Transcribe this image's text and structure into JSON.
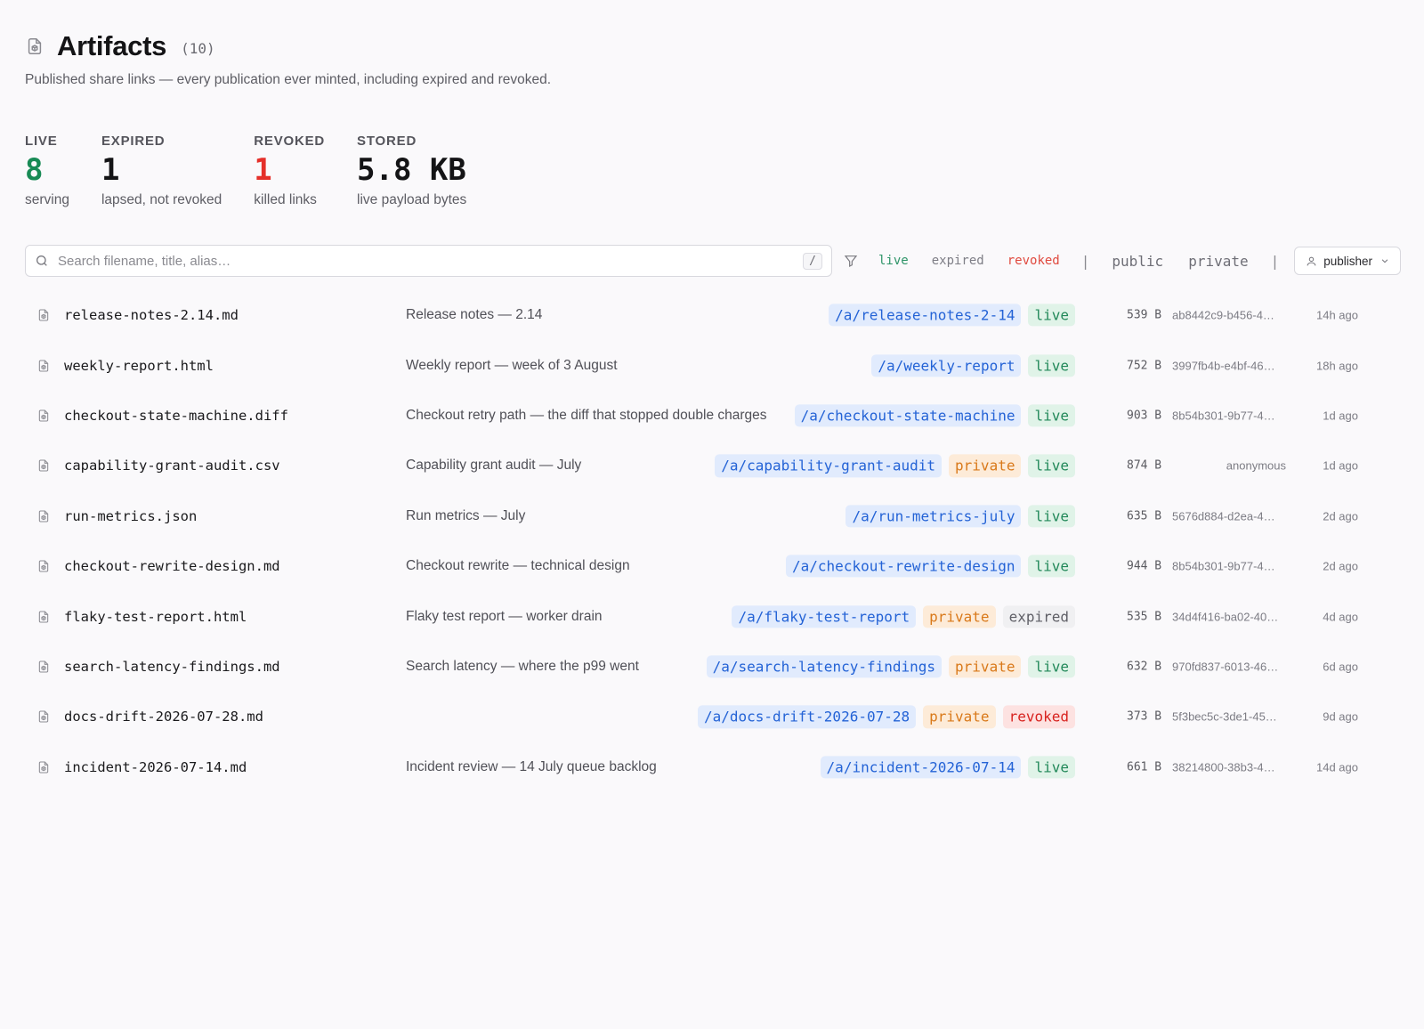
{
  "header": {
    "title": "Artifacts",
    "count": "(10)",
    "subtitle": "Published share links — every publication ever minted, including expired and revoked."
  },
  "stats": [
    {
      "key": "live",
      "label": "LIVE",
      "value": "8",
      "desc": "serving"
    },
    {
      "key": "expired",
      "label": "EXPIRED",
      "value": "1",
      "desc": "lapsed, not revoked"
    },
    {
      "key": "revoked",
      "label": "REVOKED",
      "value": "1",
      "desc": "killed links"
    },
    {
      "key": "stored",
      "label": "STORED",
      "value": "5.8 KB",
      "desc": "live payload bytes"
    }
  ],
  "search": {
    "placeholder": "Search filename, title, alias…",
    "shortcut": "/"
  },
  "filters": {
    "status": [
      "live",
      "expired",
      "revoked"
    ],
    "separator": "|",
    "visibility": [
      "public",
      "private"
    ],
    "publisher_label": "publisher"
  },
  "colors": {
    "live": "#188a55",
    "revoked": "#e5302a",
    "alias": "#2463d6",
    "private": "#d9791a"
  },
  "icons": {
    "header": "file-cube-icon",
    "search": "search-icon",
    "filter": "filter-icon",
    "publisher": "user-icon",
    "dropdown": "chevron-down-icon",
    "row": "file-cube-icon"
  },
  "artifacts": [
    {
      "filename": "release-notes-2.14.md",
      "title": "Release notes — 2.14",
      "alias": "/a/release-notes-2-14",
      "private": "",
      "status": "live",
      "size": "539 B",
      "publisher": "ab8442c9-b456-4…",
      "age": "14h ago"
    },
    {
      "filename": "weekly-report.html",
      "title": "Weekly report — week of 3 August",
      "alias": "/a/weekly-report",
      "private": "",
      "status": "live",
      "size": "752 B",
      "publisher": "3997fb4b-e4bf-46…",
      "age": "18h ago"
    },
    {
      "filename": "checkout-state-machine.diff",
      "title": "Checkout retry path — the diff that stopped double charges",
      "alias": "/a/checkout-state-machine",
      "private": "",
      "status": "live",
      "size": "903 B",
      "publisher": "8b54b301-9b77-4…",
      "age": "1d ago"
    },
    {
      "filename": "capability-grant-audit.csv",
      "title": "Capability grant audit — July",
      "alias": "/a/capability-grant-audit",
      "private": "private",
      "status": "live",
      "size": "874 B",
      "publisher": "anonymous",
      "age": "1d ago"
    },
    {
      "filename": "run-metrics.json",
      "title": "Run metrics — July",
      "alias": "/a/run-metrics-july",
      "private": "",
      "status": "live",
      "size": "635 B",
      "publisher": "5676d884-d2ea-4…",
      "age": "2d ago"
    },
    {
      "filename": "checkout-rewrite-design.md",
      "title": "Checkout rewrite — technical design",
      "alias": "/a/checkout-rewrite-design",
      "private": "",
      "status": "live",
      "size": "944 B",
      "publisher": "8b54b301-9b77-4…",
      "age": "2d ago"
    },
    {
      "filename": "flaky-test-report.html",
      "title": "Flaky test report — worker drain",
      "alias": "/a/flaky-test-report",
      "private": "private",
      "status": "expired",
      "size": "535 B",
      "publisher": "34d4f416-ba02-40…",
      "age": "4d ago"
    },
    {
      "filename": "search-latency-findings.md",
      "title": "Search latency — where the p99 went",
      "alias": "/a/search-latency-findings",
      "private": "private",
      "status": "live",
      "size": "632 B",
      "publisher": "970fd837-6013-46…",
      "age": "6d ago"
    },
    {
      "filename": "docs-drift-2026-07-28.md",
      "title": "",
      "alias": "/a/docs-drift-2026-07-28",
      "private": "private",
      "status": "revoked",
      "size": "373 B",
      "publisher": "5f3bec5c-3de1-45…",
      "age": "9d ago"
    },
    {
      "filename": "incident-2026-07-14.md",
      "title": "Incident review — 14 July queue backlog",
      "alias": "/a/incident-2026-07-14",
      "private": "",
      "status": "live",
      "size": "661 B",
      "publisher": "38214800-38b3-4…",
      "age": "14d ago"
    }
  ]
}
